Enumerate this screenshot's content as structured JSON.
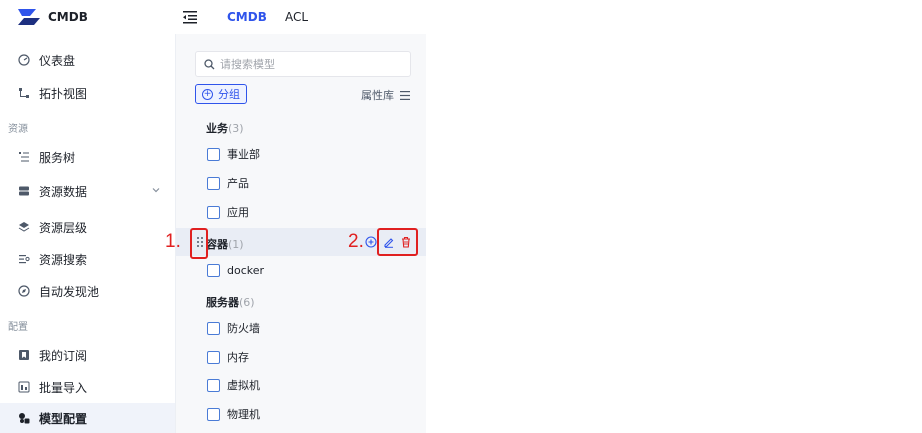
{
  "app": {
    "brand": "CMDB",
    "top_tabs": [
      "CMDB",
      "ACL"
    ],
    "accent_color": "#2f54eb"
  },
  "sidebar": {
    "items": [
      {
        "label": "仪表盘",
        "icon": "dashboard-icon"
      },
      {
        "label": "拓扑视图",
        "icon": "topology-icon"
      },
      {
        "label": "服务树",
        "icon": "tree-icon"
      },
      {
        "label": "资源数据",
        "icon": "database-icon"
      },
      {
        "label": "资源层级",
        "icon": "layers-icon"
      },
      {
        "label": "资源搜索",
        "icon": "search-list-icon"
      },
      {
        "label": "自动发现池",
        "icon": "discovery-icon"
      },
      {
        "label": "我的订阅",
        "icon": "subscribe-icon"
      },
      {
        "label": "批量导入",
        "icon": "import-icon"
      },
      {
        "label": "模型配置",
        "icon": "model-config-icon"
      }
    ],
    "groups": [
      "资源",
      "配置"
    ],
    "active": "模型配置"
  },
  "panel": {
    "search_placeholder": "请搜索模型",
    "group_button": "分组",
    "attr_lib": "属性库",
    "groups": [
      {
        "name": "业务",
        "count": "(3)",
        "items": [
          "事业部",
          "产品",
          "应用"
        ]
      },
      {
        "name": "容器",
        "count": "(1)",
        "items": [
          "docker"
        ]
      },
      {
        "name": "服务器",
        "count": "(6)",
        "items": [
          "防火墙",
          "内存",
          "虚拟机",
          "物理机"
        ]
      }
    ]
  },
  "annotations": [
    "1.",
    "2."
  ]
}
